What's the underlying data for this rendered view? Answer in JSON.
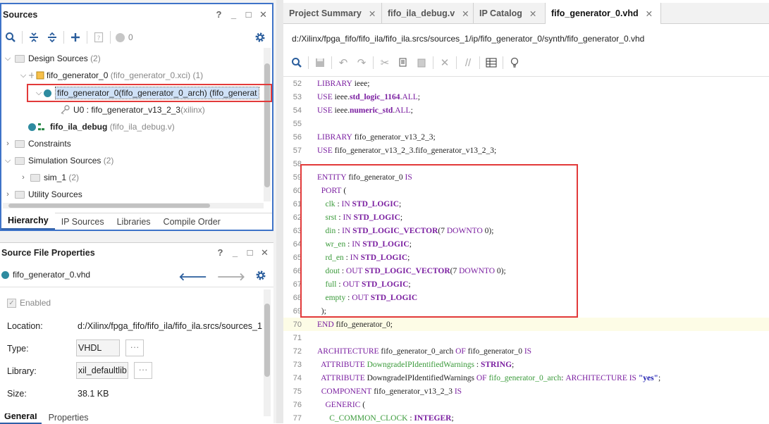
{
  "sources_panel": {
    "title": "Sources",
    "win_controls": [
      "?",
      "_",
      "□",
      "✕"
    ],
    "filter_count": "0",
    "tree": {
      "design_sources": {
        "label": "Design Sources",
        "count": "(2)"
      },
      "fifo_gen": {
        "label": "fifo_generator_0",
        "meta": "(fifo_generator_0.xci) (1)"
      },
      "fifo_gen_arch": {
        "label": "fifo_generator_0(fifo_generator_0_arch) (fifo_generat"
      },
      "u0": {
        "label": "U0 : fifo_generator_v13_2_3",
        "meta": "(xilinx)"
      },
      "ila": {
        "label": "fifo_ila_debug",
        "meta": "(fifo_ila_debug.v)"
      },
      "constraints": {
        "label": "Constraints"
      },
      "simulation": {
        "label": "Simulation Sources",
        "count": "(2)"
      },
      "sim1": {
        "label": "sim_1",
        "count": "(2)"
      },
      "utility": {
        "label": "Utility Sources"
      }
    },
    "tabs": [
      "Hierarchy",
      "IP Sources",
      "Libraries",
      "Compile Order"
    ]
  },
  "props_panel": {
    "title": "Source File Properties",
    "file": "fifo_generator_0.vhd",
    "enabled_label": "Enabled",
    "location_label": "Location:",
    "location_value": "d:/Xilinx/fpga_fifo/fifo_ila/fifo_ila.srcs/sources_1/",
    "type_label": "Type:",
    "type_value": "VHDL",
    "library_label": "Library:",
    "library_value": "xil_defaultlib",
    "size_label": "Size:",
    "size_value": "38.1 KB",
    "bottom_tabs": [
      "General",
      "Properties"
    ]
  },
  "editor": {
    "tabs": [
      "Project Summary",
      "fifo_ila_debug.v",
      "IP Catalog",
      "fifo_generator_0.vhd"
    ],
    "path": "d:/Xilinx/fpga_fifo/fifo_ila/fifo_ila.srcs/sources_1/ip/fifo_generator_0/synth/fifo_generator_0.vhd",
    "lines": [
      "52",
      "53",
      "54",
      "55",
      "56",
      "57",
      "58",
      "59",
      "60",
      "61",
      "62",
      "63",
      "64",
      "65",
      "66",
      "67",
      "68",
      "69",
      "70",
      "71",
      "72",
      "73",
      "74",
      "75",
      "76",
      "77"
    ]
  }
}
